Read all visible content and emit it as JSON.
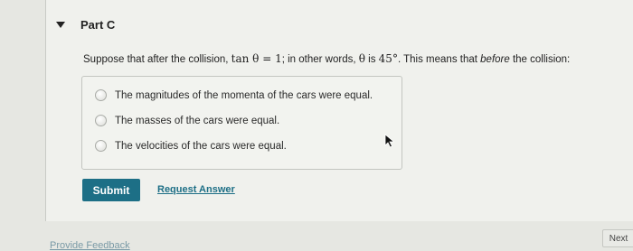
{
  "part": {
    "title": "Part C"
  },
  "question": {
    "intro": "Suppose that after the collision, ",
    "math_tan": "tan θ = 1",
    "mid": "; in other words, ",
    "math_theta": "θ",
    "is": " is ",
    "angle": "45°",
    "outro_1": ". This means that ",
    "emphasis": "before",
    "outro_2": " the collision:"
  },
  "options": [
    {
      "label": "The magnitudes of the momenta of the cars were equal."
    },
    {
      "label": "The masses of the cars were equal."
    },
    {
      "label": "The velocities of the cars were equal."
    }
  ],
  "actions": {
    "submit_label": "Submit",
    "request_answer_label": "Request Answer",
    "provide_feedback_label": "Provide Feedback",
    "next_label": "Next"
  },
  "colors": {
    "accent": "#1d6f86",
    "background": "#e6e7e2"
  },
  "icons": {
    "collapse": "caret-down-icon",
    "pointer": "mouse-cursor-icon"
  }
}
